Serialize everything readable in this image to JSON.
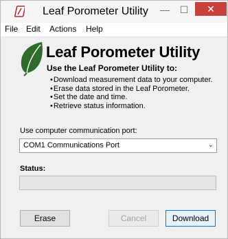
{
  "window": {
    "title": "Leaf Porometer Utility",
    "controls": {
      "minimize": "—",
      "maximize": "☐",
      "close": "✕"
    }
  },
  "menu": {
    "items": [
      "File",
      "Edit",
      "Actions",
      "Help"
    ]
  },
  "header": {
    "app_name": "Leaf Porometer Utility",
    "subtitle": "Use the Leaf Porometer Utility to:",
    "bullets": [
      "Download measurement data to your computer.",
      "Erase data stored in the Leaf Porometer.",
      "Set the date and time.",
      "Retrieve status information."
    ]
  },
  "port": {
    "label": "Use computer communication port:",
    "selected": "COM1 Communications Port"
  },
  "status": {
    "label": "Status:",
    "value": ""
  },
  "buttons": {
    "erase": "Erase",
    "cancel": "Cancel",
    "download": "Download"
  },
  "colors": {
    "close_button": "#c7413b",
    "leaf_green": "#2f6b2a",
    "icon_red": "#b8262b"
  },
  "icons": {
    "app_icon": "app-logo-icon",
    "leaf": "leaf-logo-icon",
    "dropdown": "chevron-down-icon"
  }
}
